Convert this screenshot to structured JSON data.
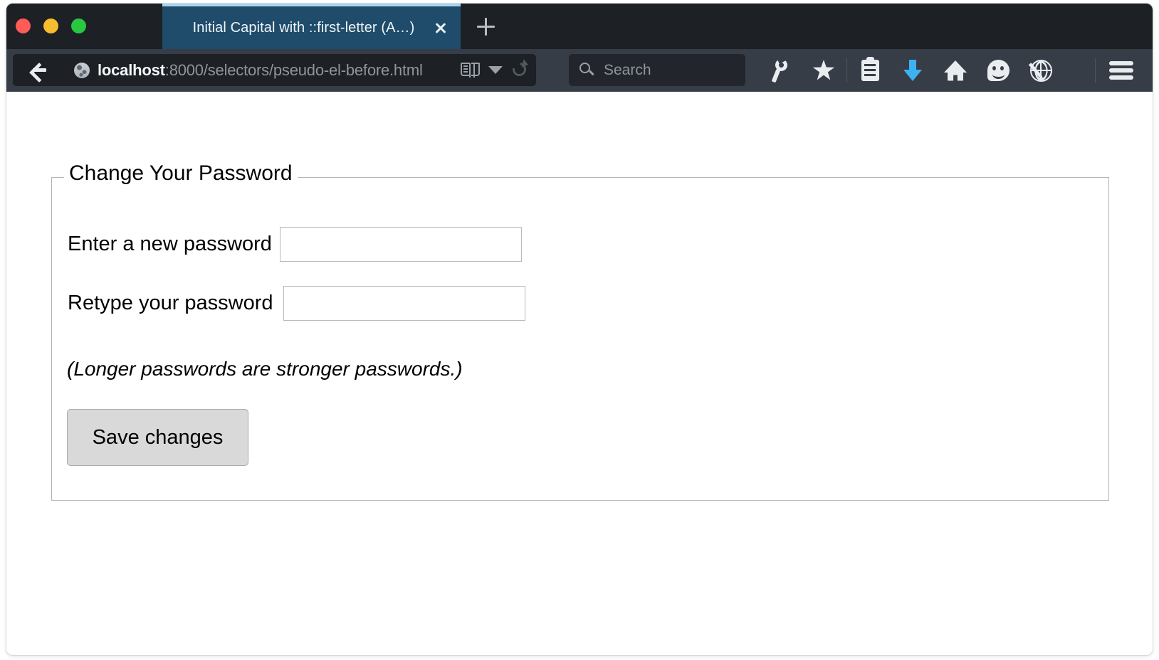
{
  "window": {
    "traffic_lights": {
      "close_color": "#fd5c57",
      "minimize_color": "#f8bd2f",
      "maximize_color": "#28c841"
    }
  },
  "tab_bar": {
    "active_tab_title": "Initial Capital with ::first-letter (A…)",
    "close_tab_label": "",
    "new_tab_label": "",
    "active_tab_color": "#1f4c6b",
    "active_tab_accent": "#a8d4ec"
  },
  "nav_bar": {
    "url_host": "localhost",
    "url_path": ":8000/selectors/pseudo-el-before.html",
    "url_full": "localhost:8000/selectors/pseudo-el-before.html",
    "back_icon": "back-arrow-icon",
    "site_identity_icon": "globe-icon",
    "reader_mode_icon": "reader-mode-icon",
    "url_dropdown_icon": "chevron-down-icon",
    "reload_icon": "reload-icon",
    "search": {
      "placeholder": "Search",
      "icon": "search-icon",
      "value": ""
    },
    "toolbar_icons": [
      {
        "name": "wrench-icon",
        "label": "Developer Tools"
      },
      {
        "name": "bookmark-star-icon",
        "label": "Bookmark"
      },
      {
        "name": "reading-list-icon",
        "label": "Reading List"
      },
      {
        "name": "downloads-icon",
        "label": "Downloads",
        "color": "#3db2f0"
      },
      {
        "name": "home-icon",
        "label": "Home"
      },
      {
        "name": "feedback-icon",
        "label": "Feedback"
      },
      {
        "name": "sync-icon",
        "label": "Sync"
      }
    ],
    "menu_icon": "hamburger-icon"
  },
  "page": {
    "fieldset_legend": "Change Your Password",
    "fields": [
      {
        "label": "Enter a new password",
        "value": "",
        "placeholder": ""
      },
      {
        "label": "Retype your password",
        "value": "",
        "placeholder": ""
      }
    ],
    "hint": "(Longer passwords are stronger passwords.)",
    "submit_label": "Save changes"
  },
  "colors": {
    "chrome_tabbar": "#1d2024",
    "chrome_navbar": "#363d47",
    "page_background": "#ffffff",
    "fieldset_border": "#b4b4b4",
    "input_border": "#b9b9b9",
    "button_face": "#d9d9d9",
    "button_border": "#a9a9a9"
  }
}
